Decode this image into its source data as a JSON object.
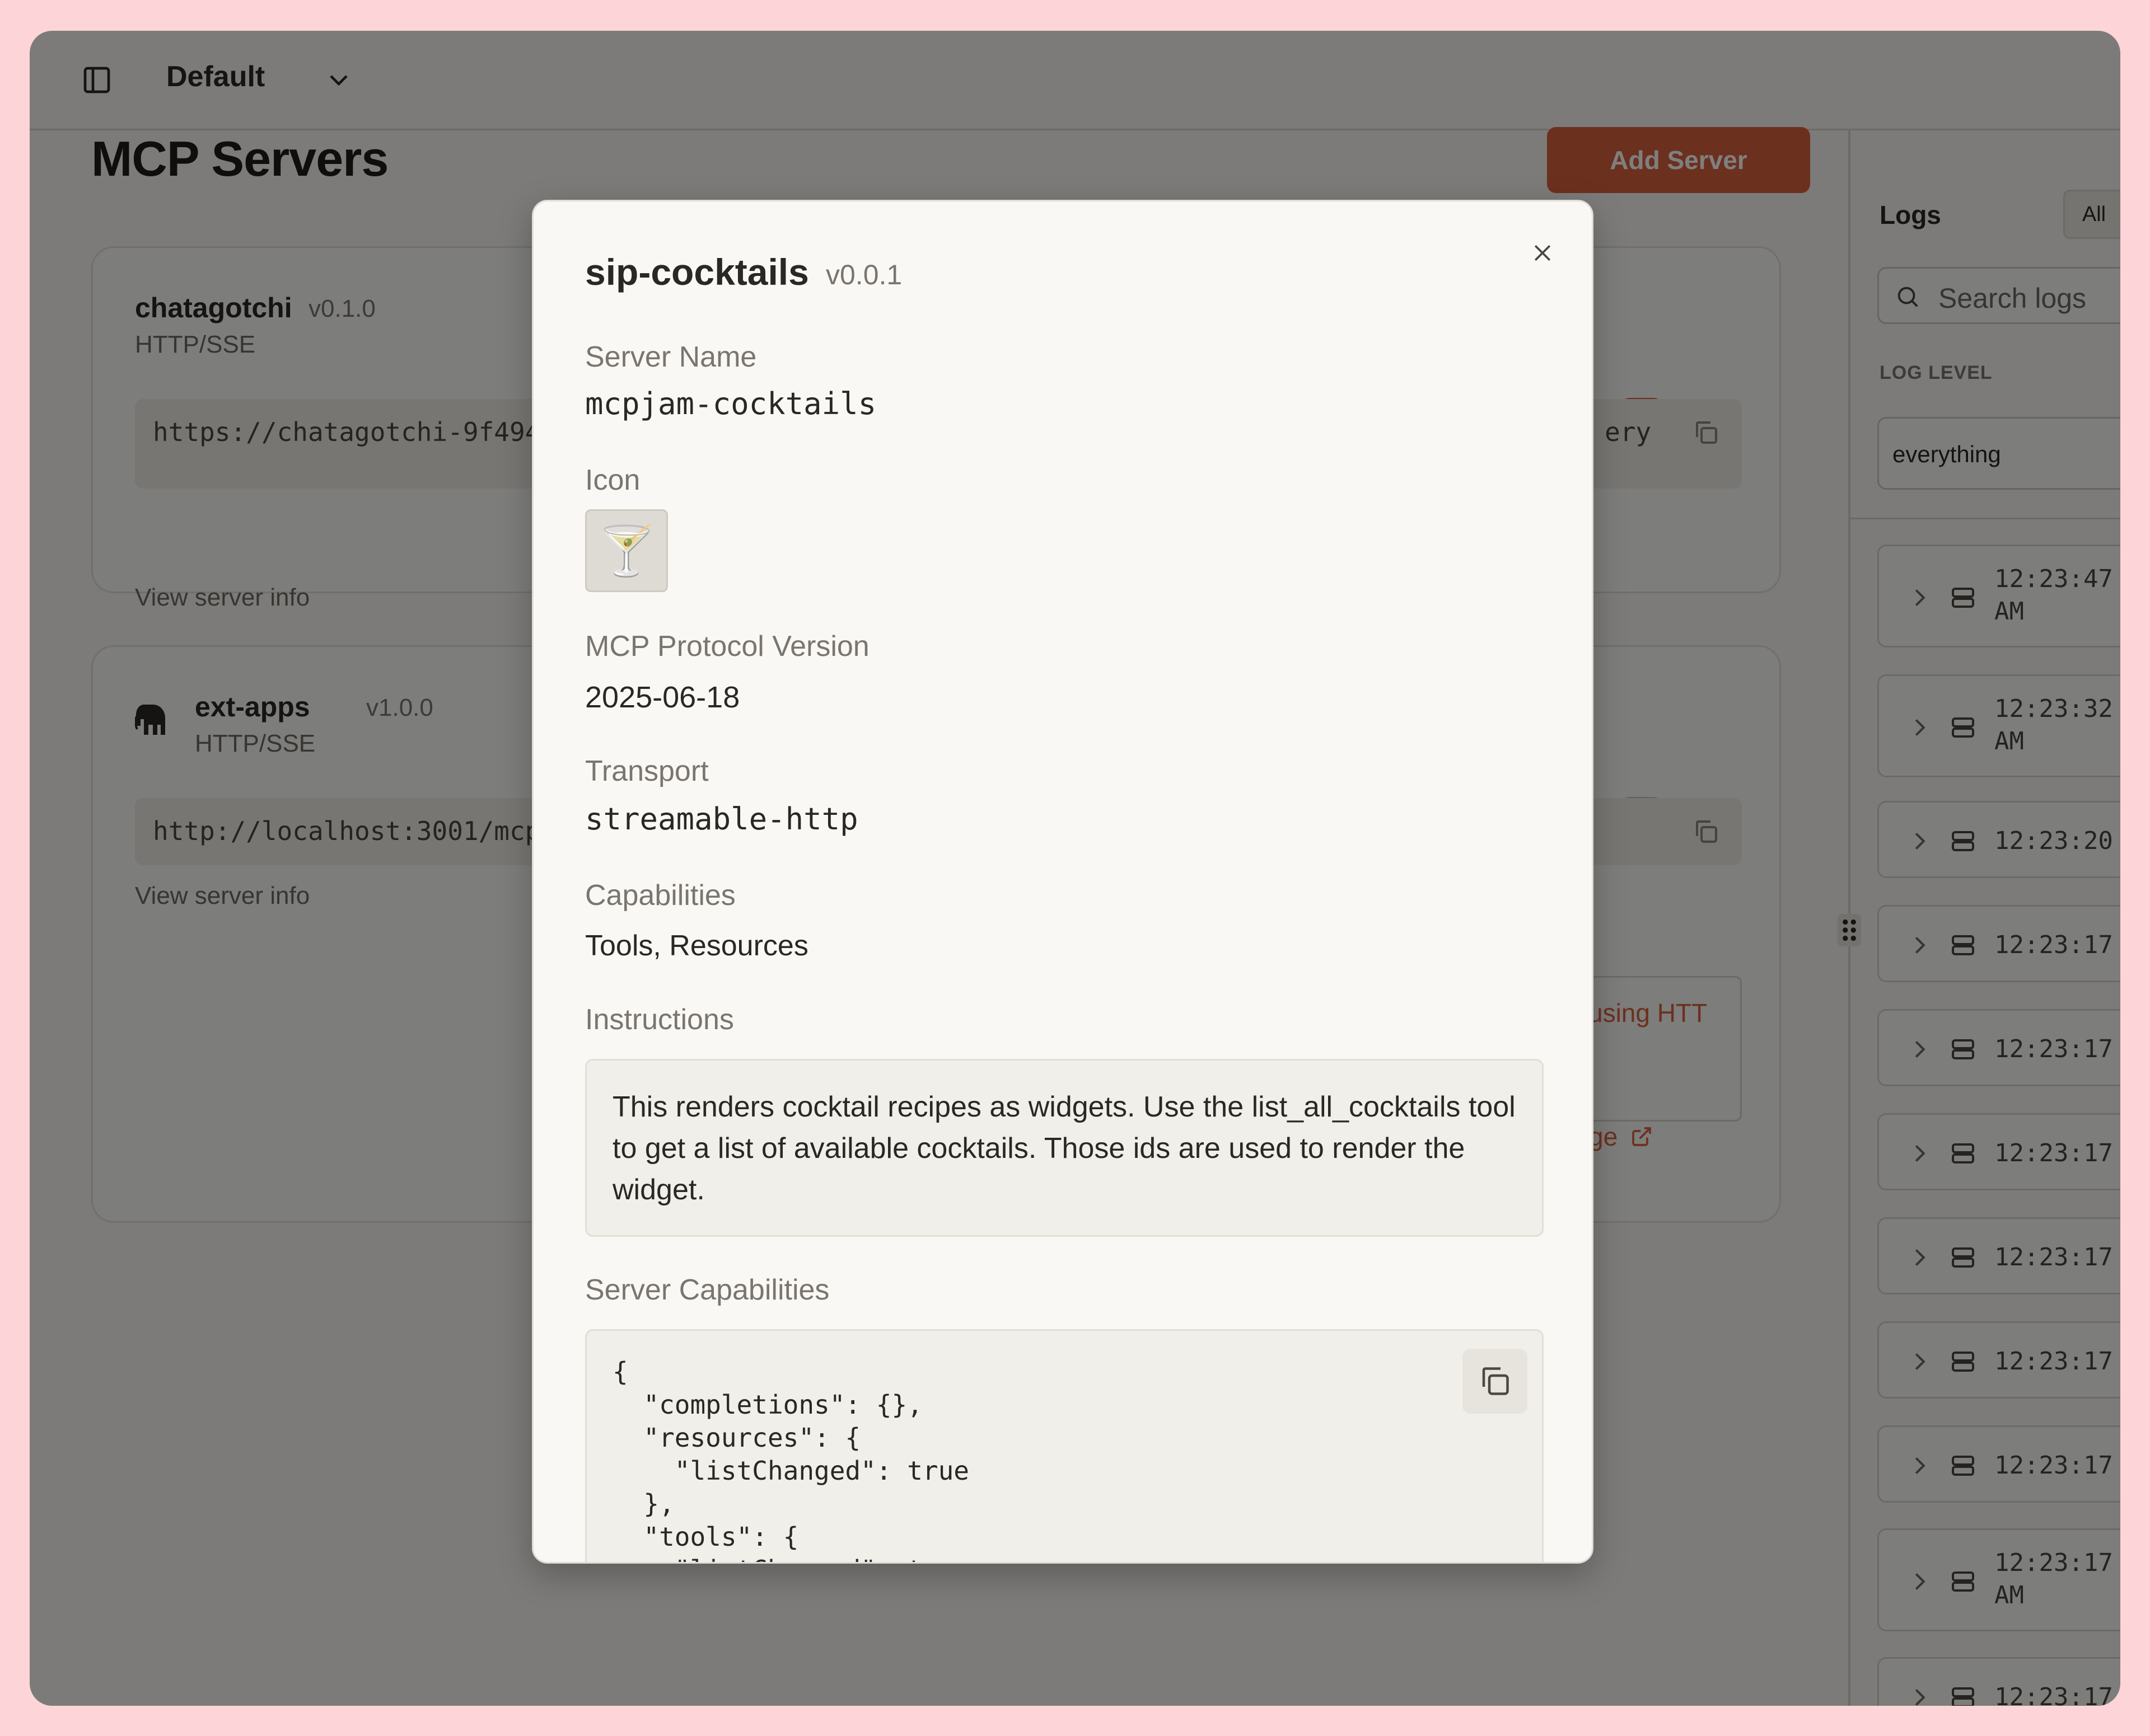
{
  "topbar": {
    "workspace": "Default"
  },
  "page": {
    "title": "MCP Servers",
    "add_server_label": "Add Server"
  },
  "servers": [
    {
      "name": "chatagotchi",
      "version": "v0.1.0",
      "transport": "HTTP/SSE",
      "url": "https://chatagotchi-9f494",
      "url_suffix": "ery",
      "view_info": "View server info",
      "enabled": true
    },
    {
      "name": "ext-apps",
      "version": "v1.0.0",
      "transport": "HTTP/SSE",
      "url": "http://localhost:3001/mcp",
      "view_info": "View server info",
      "enabled": false,
      "error_text": "using HTT",
      "page_link": "ge"
    }
  ],
  "logs": {
    "title": "Logs",
    "tab_all": "All",
    "search_placeholder": "Search logs",
    "level_label": "LOG LEVEL",
    "level_value": "everything",
    "entries": [
      {
        "time": "12:23:47",
        "suffix": "AM"
      },
      {
        "time": "12:23:32",
        "suffix": "AM"
      },
      {
        "time": "12:23:20",
        "suffix": ""
      },
      {
        "time": "12:23:17",
        "suffix": ""
      },
      {
        "time": "12:23:17",
        "suffix": ""
      },
      {
        "time": "12:23:17",
        "suffix": ""
      },
      {
        "time": "12:23:17",
        "suffix": ""
      },
      {
        "time": "12:23:17",
        "suffix": ""
      },
      {
        "time": "12:23:17",
        "suffix": ""
      },
      {
        "time": "12:23:17",
        "suffix": "AM"
      },
      {
        "time": "12:23:17",
        "suffix": ""
      }
    ]
  },
  "modal": {
    "title": "sip-cocktails",
    "version": "v0.0.1",
    "server_name_label": "Server Name",
    "server_name": "mcpjam-cocktails",
    "icon_label": "Icon",
    "icon_glyph": "🍸",
    "protocol_label": "MCP Protocol Version",
    "protocol_version": "2025-06-18",
    "transport_label": "Transport",
    "transport": "streamable-http",
    "capabilities_label": "Capabilities",
    "capabilities": "Tools, Resources",
    "instructions_label": "Instructions",
    "instructions": "This renders cocktail recipes as widgets. Use the list_all_cocktails tool to get a list of available cocktails. Those ids are used to render the widget.",
    "server_caps_label": "Server Capabilities",
    "server_caps_json": "{\n  \"completions\": {},\n  \"resources\": {\n    \"listChanged\": true\n  },\n  \"tools\": {\n    \"listChanged\": true\n  }\n}"
  }
}
